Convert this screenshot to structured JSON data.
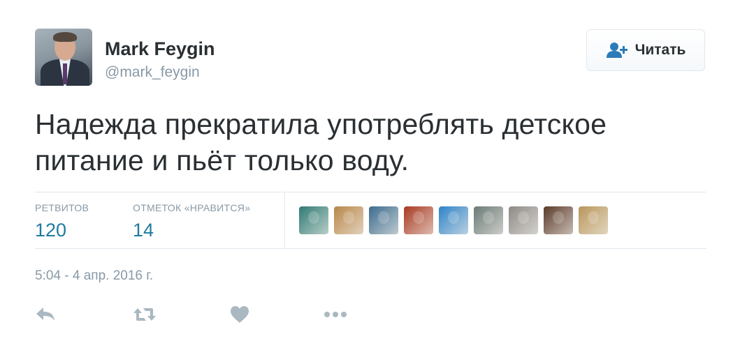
{
  "author": {
    "name": "Mark Feygin",
    "handle": "@mark_feygin"
  },
  "follow_button": {
    "label": "Читать",
    "icon": "follow-person-plus-icon"
  },
  "tweet": {
    "text": "Надежда прекратила употреблять детское питание и пьёт только воду."
  },
  "stats": {
    "retweets_label": "РЕТВИТОВ",
    "retweets_value": "120",
    "likes_label": "ОТМЕТОК «НРАВИТСЯ»",
    "likes_value": "14"
  },
  "likers": [
    {
      "name": "liker-avatar-1",
      "color": "#2f7a74"
    },
    {
      "name": "liker-avatar-2",
      "color": "#b8874a"
    },
    {
      "name": "liker-avatar-3",
      "color": "#3c6c8e"
    },
    {
      "name": "liker-avatar-4",
      "color": "#a83a22"
    },
    {
      "name": "liker-avatar-5",
      "color": "#2f83c8"
    },
    {
      "name": "liker-avatar-6",
      "color": "#6b7a76"
    },
    {
      "name": "liker-avatar-7",
      "color": "#8d8a86"
    },
    {
      "name": "liker-avatar-8",
      "color": "#5b3b2a"
    },
    {
      "name": "liker-avatar-9",
      "color": "#b9965a"
    }
  ],
  "timestamp": "5:04 - 4 апр. 2016 г.",
  "actions": {
    "reply_icon": "reply-icon",
    "retweet_icon": "retweet-icon",
    "like_icon": "heart-icon",
    "more_icon": "more-dots-icon"
  },
  "colors": {
    "link_blue": "#1f7aa1",
    "muted": "#8899a6",
    "text": "#292f33",
    "follow_icon": "#2b7bb9",
    "action_icon": "#aab8c2"
  }
}
